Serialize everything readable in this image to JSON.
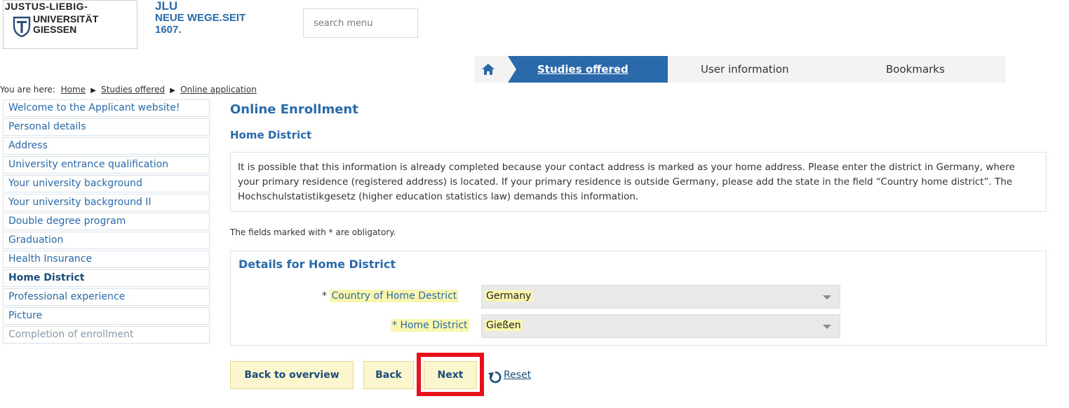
{
  "header": {
    "logo_top": "JUSTUS-LIEBIG-",
    "logo_line1": "UNIVERSITÄT",
    "logo_line2": "GIESSEN",
    "brand_line1": "JLU",
    "brand_line2": "NEUE WEGE.SEIT",
    "brand_line3": "1607.",
    "search_placeholder": "search menu"
  },
  "nav": {
    "tabs": [
      {
        "label": "Studies offered",
        "active": true
      },
      {
        "label": "User information",
        "active": false
      },
      {
        "label": "Bookmarks",
        "active": false
      }
    ],
    "accent": "#2a6aab"
  },
  "breadcrumb": {
    "prefix": "You are here:",
    "items": [
      "Home",
      "Studies offered",
      "Online application"
    ]
  },
  "sidebar": {
    "items": [
      {
        "label": "Welcome to the Applicant website!"
      },
      {
        "label": "Personal details"
      },
      {
        "label": "Address"
      },
      {
        "label": "University entrance qualification"
      },
      {
        "label": "Your university background"
      },
      {
        "label": "Your university background II"
      },
      {
        "label": "Double degree program"
      },
      {
        "label": "Graduation"
      },
      {
        "label": "Health Insurance"
      },
      {
        "label": "Home District",
        "active": true
      },
      {
        "label": "Professional experience"
      },
      {
        "label": "Picture"
      },
      {
        "label": "Completion of enrollment",
        "disabled": true
      }
    ]
  },
  "main": {
    "title": "Online Enrollment",
    "subtitle": "Home District",
    "info_text": "It is possible that this information is already completed because your contact address is marked as your home address. Please enter the district in Germany, where your primary residence (registered address) is located. If your primary residence is outside Germany, please add the state in the field “Country home district”. The Hochschulstatistikgesetz (higher education statistics law) demands this information.",
    "obligatory_note": "The fields marked with * are obligatory.",
    "details_title": "Details for Home District",
    "fields": {
      "country": {
        "asterisk": "*",
        "label": "Country of Home Destrict",
        "value": "Germany"
      },
      "district": {
        "asterisk": "*",
        "label": "Home District",
        "value": "Gießen"
      }
    },
    "buttons": {
      "back_overview": "Back to overview",
      "back": "Back",
      "next": "Next",
      "reset": "Reset"
    }
  }
}
